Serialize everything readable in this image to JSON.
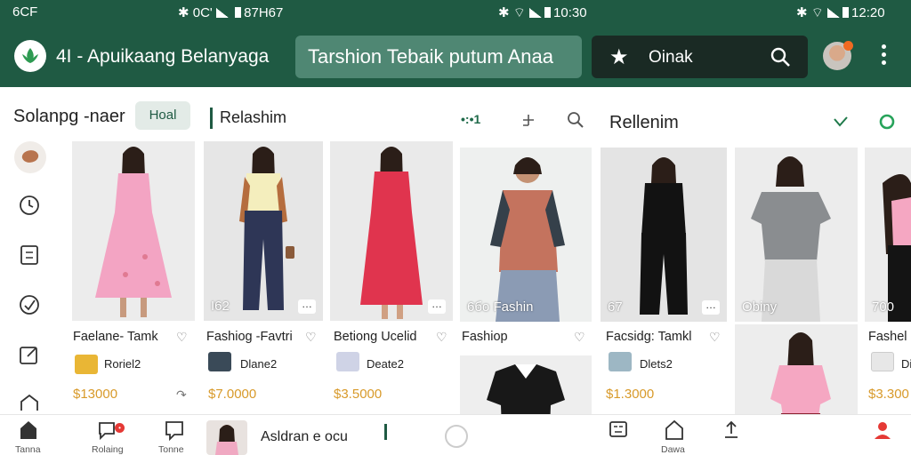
{
  "status_bar": {
    "left_text": "6CF",
    "left_mid": "0C'",
    "left_tail": "87H67",
    "mid_time": "10:30",
    "right_time": "12:20"
  },
  "app_bar": {
    "title": "4I - Apuikaang Belanyaga",
    "banner": "Tarshion Tebaik putum Anaa",
    "search_text": "Oinak"
  },
  "sections": {
    "shop_title": "Solanpg -naer",
    "chip": "Hoal",
    "main_title": "Relashim",
    "main_count": "•:•1",
    "right_title": "Rellenim"
  },
  "colors": {
    "primary": "#1f5a43",
    "price": "#d89a2a",
    "chip_bg": "#e3ebe7"
  },
  "products": [
    {
      "name": "Faelane- Tamk",
      "overlay": "",
      "shop": "Roriel2",
      "price": "$13000",
      "thumb_color": "#e9b635",
      "image": "pink-dress"
    },
    {
      "name": "Fashiog -Favtri",
      "overlay": "I62",
      "shop": "Dlane2",
      "price": "$7.0000",
      "thumb_color": "#3a4a58",
      "image": "yellow-top-navy-pants"
    },
    {
      "name": "Betiong Ucelid",
      "overlay": "",
      "shop": "Deate2",
      "price": "$3.5000",
      "thumb_color": "#cfd3e6",
      "image": "red-dress"
    },
    {
      "name": "Fashiop",
      "overlay": "6бо Fashin",
      "shop": "",
      "price": "",
      "thumb_color": "",
      "image": "man-polo"
    },
    {
      "name": "Facsidg: Tamkl",
      "overlay": "67",
      "shop": "Dlets2",
      "price": "$1.3000",
      "thumb_color": "#9db7c4",
      "image": "black-outfit"
    },
    {
      "name": "",
      "overlay": "Obiny",
      "shop": "",
      "price": "",
      "thumb_color": "",
      "image": "grey-tee"
    },
    {
      "name": "Fashel",
      "overlay": "700",
      "shop": "Di",
      "price": "$3.300",
      "thumb_color": "#e7e7e7",
      "image": "pink-partial"
    }
  ],
  "bottom_nav": [
    {
      "label": "Tanna",
      "icon": "home-icon"
    },
    {
      "label": "Rolaing",
      "icon": "chat-icon"
    },
    {
      "label": "Tonne",
      "icon": "message-icon"
    },
    {
      "label": "Dawa",
      "icon": "store-icon"
    }
  ],
  "mini_player": {
    "text": "Asldran e ocu"
  }
}
